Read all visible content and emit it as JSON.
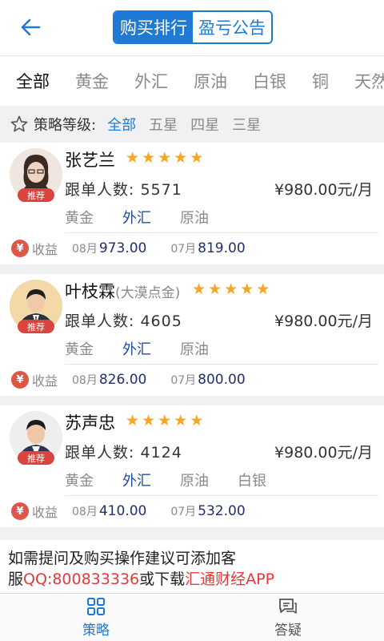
{
  "header": {
    "tabs": [
      {
        "label": "购买排行",
        "active": true
      },
      {
        "label": "盈亏公告",
        "active": false
      }
    ]
  },
  "category_tabs": [
    {
      "label": "全部",
      "active": true
    },
    {
      "label": "黄金",
      "active": false
    },
    {
      "label": "外汇",
      "active": false
    },
    {
      "label": "原油",
      "active": false
    },
    {
      "label": "白银",
      "active": false
    },
    {
      "label": "铜",
      "active": false
    },
    {
      "label": "天然",
      "active": false
    }
  ],
  "filter": {
    "label": "策略等级:",
    "options": [
      {
        "label": "全部",
        "active": true
      },
      {
        "label": "五星",
        "active": false
      },
      {
        "label": "四星",
        "active": false
      },
      {
        "label": "三星",
        "active": false
      }
    ]
  },
  "strategists": [
    {
      "name": "张艺兰",
      "suffix": "",
      "badge": "推荐",
      "stars": 5,
      "followers_label": "跟单人数:",
      "followers": "5571",
      "price": "¥980.00元/月",
      "categories": [
        {
          "label": "黄金",
          "highlight": false
        },
        {
          "label": "外汇",
          "highlight": true
        },
        {
          "label": "原油",
          "highlight": false
        }
      ],
      "profit_label": "收益",
      "profits": [
        {
          "month": "08月",
          "value": "973.00"
        },
        {
          "month": "07月",
          "value": "819.00"
        }
      ]
    },
    {
      "name": "叶枝霖",
      "suffix": "(大漠点金)",
      "badge": "推荐",
      "stars": 5,
      "followers_label": "跟单人数:",
      "followers": "4605",
      "price": "¥980.00元/月",
      "categories": [
        {
          "label": "黄金",
          "highlight": false
        },
        {
          "label": "外汇",
          "highlight": true
        },
        {
          "label": "原油",
          "highlight": false
        }
      ],
      "profit_label": "收益",
      "profits": [
        {
          "month": "08月",
          "value": "826.00"
        },
        {
          "month": "07月",
          "value": "800.00"
        }
      ]
    },
    {
      "name": "苏声忠",
      "suffix": "",
      "badge": "推荐",
      "stars": 5,
      "followers_label": "跟单人数:",
      "followers": "4124",
      "price": "¥980.00元/月",
      "categories": [
        {
          "label": "黄金",
          "highlight": false
        },
        {
          "label": "外汇",
          "highlight": true
        },
        {
          "label": "原油",
          "highlight": false
        },
        {
          "label": "白银",
          "highlight": false
        }
      ],
      "profit_label": "收益",
      "profits": [
        {
          "month": "08月",
          "value": "410.00"
        },
        {
          "month": "07月",
          "value": "532.00"
        }
      ]
    }
  ],
  "note": {
    "line1": "如需提问及购买操作建议可添加客",
    "prefix": "服",
    "qq": "QQ:800833336",
    "middle": "或下载",
    "app": "汇通财经APP"
  },
  "bottom_nav": [
    {
      "label": "策略",
      "icon": "grid-icon",
      "active": true
    },
    {
      "label": "答疑",
      "icon": "chat-icon",
      "active": false
    }
  ],
  "colors": {
    "accent": "#1f7ad6",
    "star": "#f5a623",
    "badge": "#d9453e",
    "highlight_text": "#e23b3b"
  }
}
